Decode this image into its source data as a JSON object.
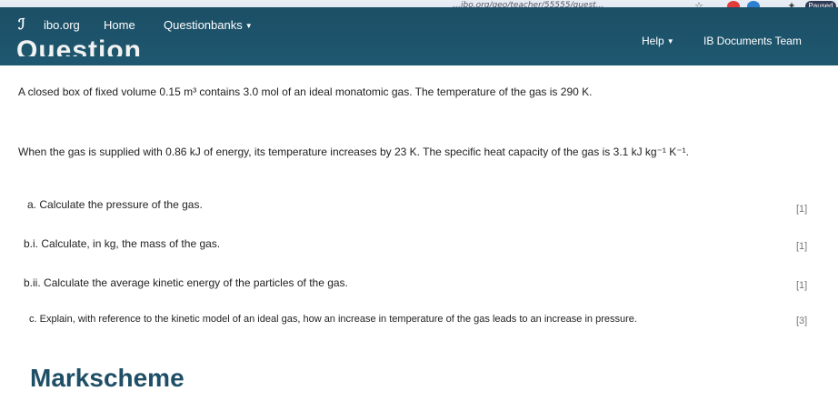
{
  "browser": {
    "url_fragment": "…ibo.org/geo/teacher/55555/quest…",
    "profile_label": "Paused"
  },
  "navbar": {
    "site_name": "ibo.org",
    "home_label": "Home",
    "questionbanks_label": "Questionbanks",
    "help_label": "Help",
    "account_label": "IB Documents Team"
  },
  "question": {
    "heading": "Question",
    "intro": "A closed box of fixed volume 0.15 m³ contains 3.0 mol of an ideal monatomic gas. The temperature of the gas is 290 K.",
    "context": "When the gas is supplied with 0.86 kJ of energy, its temperature increases by 23 K. The specific heat capacity of the gas is 3.1 kJ kg⁻¹ K⁻¹.",
    "parts": [
      {
        "label": "a.",
        "text": "Calculate the pressure of the gas.",
        "marks": "[1]"
      },
      {
        "label": "b.i.",
        "text": "Calculate, in kg, the mass of the gas.",
        "marks": "[1]"
      },
      {
        "label": "b.ii.",
        "text": "Calculate the average kinetic energy of the particles of the gas.",
        "marks": "[1]"
      },
      {
        "label": "c.",
        "text": "Explain, with reference to the kinetic model of an ideal gas, how an increase in temperature of the gas leads to an increase in pressure.",
        "marks": "[3]"
      }
    ]
  },
  "markscheme_heading": "Markscheme",
  "colors": {
    "navbar": "#1c4f66",
    "heading_accent": "#1e4f66"
  }
}
